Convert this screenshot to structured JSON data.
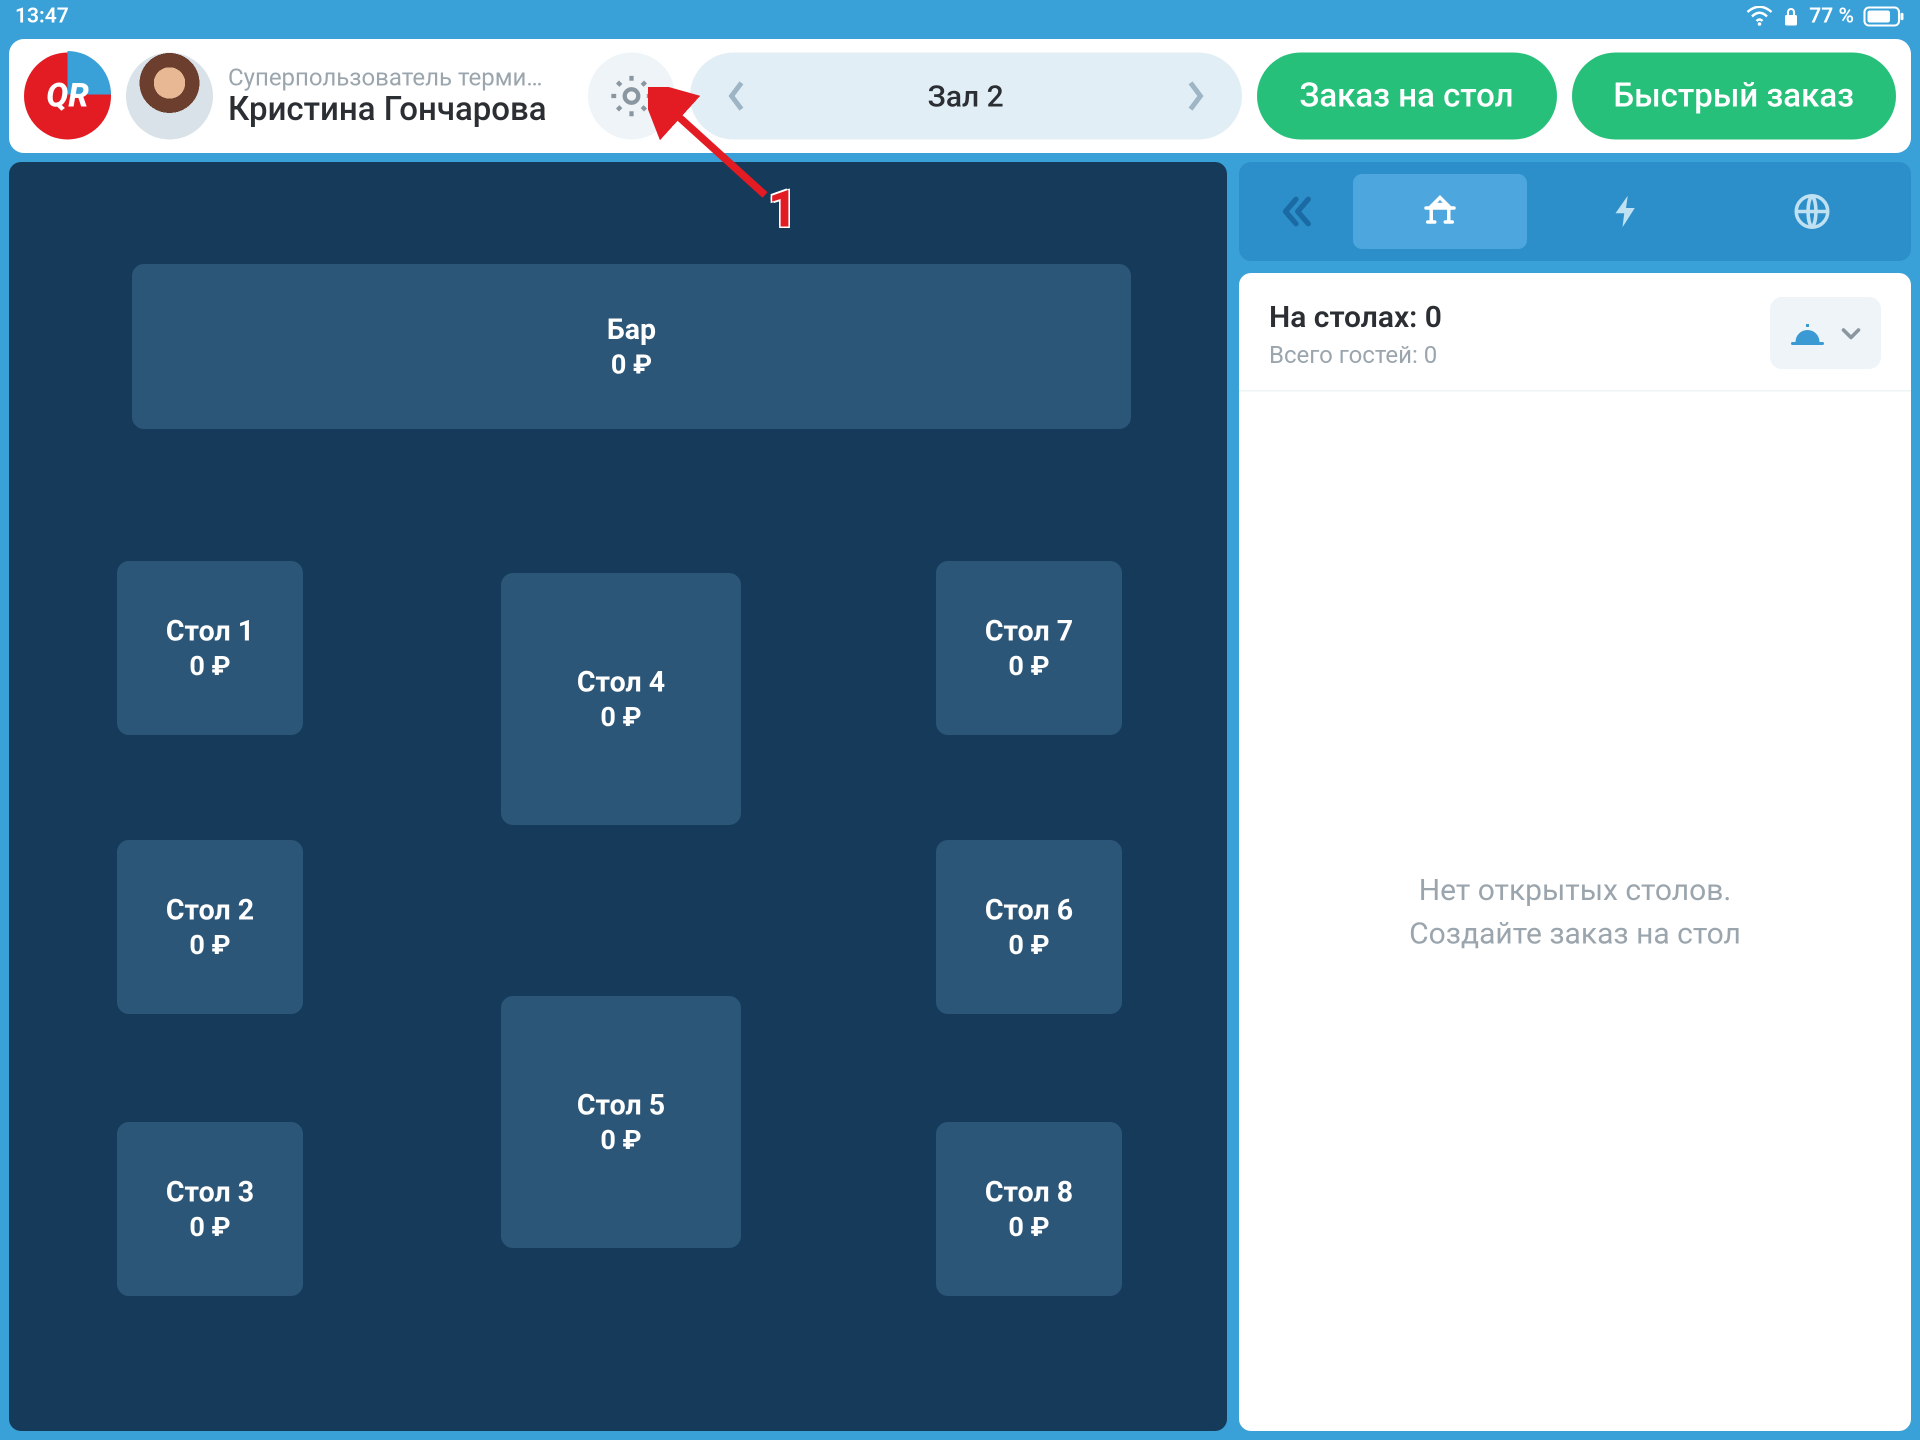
{
  "status": {
    "time": "13:47",
    "battery": "77 %"
  },
  "header": {
    "logo_text": "QR",
    "user_role": "Суперпользователь терми…",
    "user_name": "Кристина Гончарова",
    "room": "Зал 2",
    "order_table": "Заказ на стол",
    "quick_order": "Быстрый заказ"
  },
  "tables": {
    "bar": {
      "name": "Бар",
      "price": "0 ₽"
    },
    "t1": {
      "name": "Стол 1",
      "price": "0 ₽"
    },
    "t2": {
      "name": "Стол 2",
      "price": "0 ₽"
    },
    "t3": {
      "name": "Стол 3",
      "price": "0 ₽"
    },
    "t4": {
      "name": "Стол 4",
      "price": "0 ₽"
    },
    "t5": {
      "name": "Стол 5",
      "price": "0 ₽"
    },
    "t6": {
      "name": "Стол 6",
      "price": "0 ₽"
    },
    "t7": {
      "name": "Стол 7",
      "price": "0 ₽"
    },
    "t8": {
      "name": "Стол 8",
      "price": "0 ₽"
    }
  },
  "side": {
    "title": "На столах: 0",
    "guests": "Всего гостей: 0",
    "empty1": "Нет открытых столов.",
    "empty2": "Создайте заказ на стол"
  },
  "annotation": {
    "num": "1"
  }
}
